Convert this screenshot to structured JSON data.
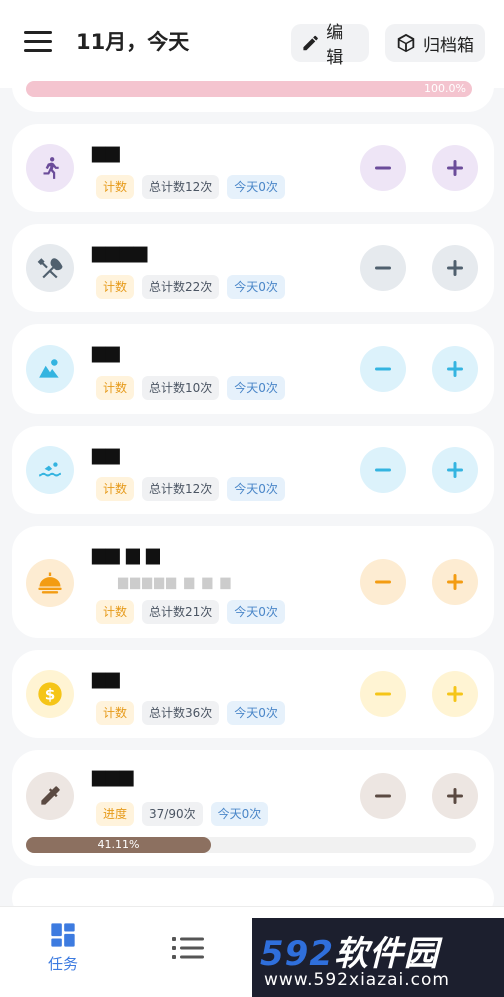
{
  "header": {
    "title": "11月，今天",
    "edit_label": "编辑",
    "archive_label": "归档箱"
  },
  "top_progress": {
    "label": "100.0%",
    "value": 1.0,
    "color": "#f4c4cf"
  },
  "tasks": [
    {
      "name": "▆▆",
      "icon": "running-person-icon",
      "tint": "#eee5f6",
      "accent": "#6b4c9a",
      "tags": {
        "type": "计数",
        "total": "总计数12次",
        "today": "今天0次"
      }
    },
    {
      "name": "▆▆▆▆",
      "icon": "fork-spoon-icon",
      "tint": "#e6eaee",
      "accent": "#50606e",
      "tags": {
        "type": "计数",
        "total": "总计数22次",
        "today": "今天0次"
      }
    },
    {
      "name": "▆▆",
      "icon": "mountain-icon",
      "tint": "#dcf2fb",
      "accent": "#34b4e0",
      "tags": {
        "type": "计数",
        "total": "总计数10次",
        "today": "今天0次"
      }
    },
    {
      "name": "▆▆",
      "icon": "swimming-icon",
      "tint": "#dcf2fb",
      "accent": "#34b4e0",
      "tags": {
        "type": "计数",
        "total": "总计数12次",
        "today": "今天0次"
      }
    },
    {
      "name": "▆▆ ▆ ▆",
      "subtitle": "▆▆▆▆▆  ▆  ▆  ▆",
      "icon": "food-cover-icon",
      "tint": "#fdecd2",
      "accent": "#f39c12",
      "tags": {
        "type": "计数",
        "total": "总计数21次",
        "today": "今天0次"
      }
    },
    {
      "name": "▆▆",
      "icon": "dollar-coin-icon",
      "tint": "#fff4d3",
      "accent": "#f5c518",
      "tags": {
        "type": "计数",
        "total": "总计数36次",
        "today": "今天0次"
      }
    },
    {
      "name": "▆▆▆",
      "icon": "eyedropper-icon",
      "tint": "#ede6e2",
      "accent": "#5b4a42",
      "tags": {
        "type": "进度",
        "total": "37/90次",
        "today": "今天0次"
      },
      "progress": {
        "label": "41.11%",
        "value": 0.4111
      }
    }
  ],
  "nav": {
    "tasks_label": "任务"
  },
  "watermark": {
    "digits": "592",
    "cn": "软件园",
    "url": "www.592xiazai.com"
  }
}
